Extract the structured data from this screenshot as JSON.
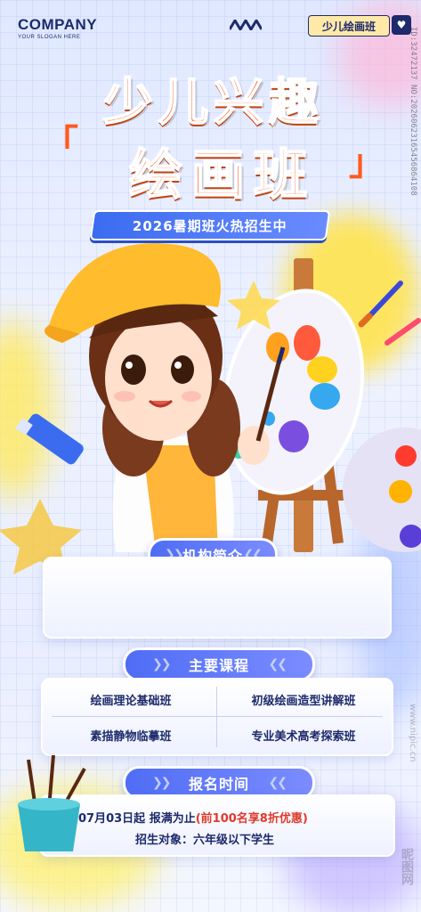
{
  "header": {
    "company_name": "COMPANY",
    "slogan": "YOUR SLOGAN HERE",
    "badge_label": "少儿绘画班",
    "badge_icon": "heart-icon"
  },
  "hero": {
    "title_line1": "少儿兴趣",
    "title_line2": "绘画班",
    "subtitle": "2026暑期班火热招生中",
    "illustration": "girl-painting-at-easel"
  },
  "intro": {
    "heading": "机构简介",
    "body": ""
  },
  "courses": {
    "heading": "主要课程",
    "items": [
      "绘画理论基础班",
      "初级绘画造型讲解班",
      "素描静物临摹班",
      "专业美术高考探索班"
    ]
  },
  "registration": {
    "heading": "报名时间",
    "line1_prefix": "07月03日起 报满为止",
    "line1_highlight": "(前100名享8折优惠)",
    "line2": "招生对象：六年级以下学生"
  },
  "watermark": {
    "id_text": "ID:32472137 NO:20260623165456864108",
    "site": "昵图网",
    "url": "www.nipic.cn"
  },
  "colors": {
    "title_orange": "#ff5a1f",
    "accent_blue": "#4f6df5",
    "navy": "#1d2a6b",
    "highlight_red": "#e0392b",
    "splash_yellow": "#ffe34d"
  }
}
